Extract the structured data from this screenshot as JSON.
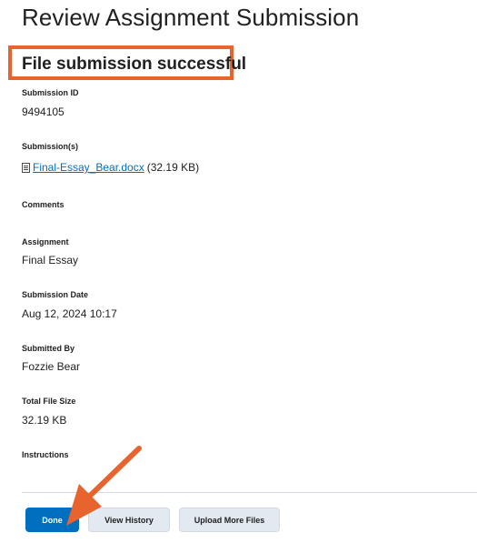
{
  "page": {
    "title": "Review Assignment Submission",
    "success_message": "File submission successful"
  },
  "fields": {
    "submission_id": {
      "label": "Submission ID",
      "value": "9494105"
    },
    "submissions": {
      "label": "Submission(s)",
      "file_name": "Final-Essay_Bear.docx",
      "file_size": "(32.19 KB)"
    },
    "comments": {
      "label": "Comments"
    },
    "assignment": {
      "label": "Assignment",
      "value": "Final Essay"
    },
    "submission_date": {
      "label": "Submission Date",
      "value": "Aug 12, 2024 10:17"
    },
    "submitted_by": {
      "label": "Submitted By",
      "value": "Fozzie Bear"
    },
    "total_file_size": {
      "label": "Total File Size",
      "value": "32.19 KB"
    },
    "instructions": {
      "label": "Instructions"
    }
  },
  "buttons": {
    "done": "Done",
    "view_history": "View History",
    "upload_more_files": "Upload More Files"
  },
  "colors": {
    "primary": "#006fbf",
    "annotation": "#e8642f",
    "secondary_button": "#e3e9f1"
  }
}
